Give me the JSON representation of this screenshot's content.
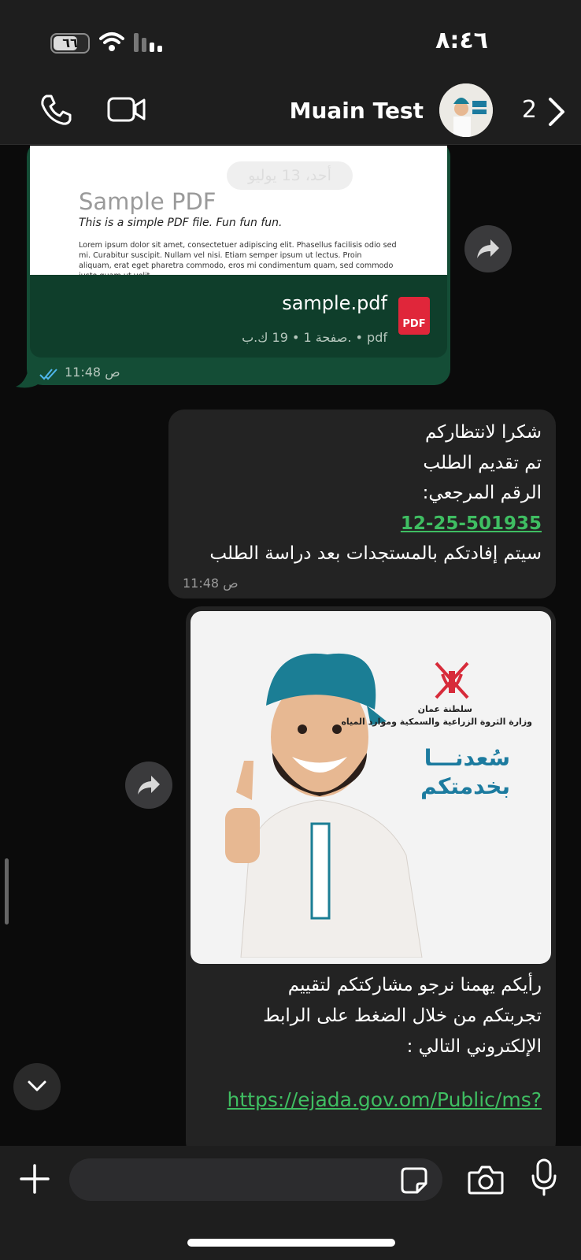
{
  "status_bar": {
    "time": "٨:٤٦",
    "battery": "٦٦"
  },
  "header": {
    "contact_name": "Muain Test",
    "back_count": "2"
  },
  "pdf_message": {
    "preview_date": "أحد، 13 يوليو",
    "preview_title": "Sample PDF",
    "preview_subtitle": "This is a simple PDF file. Fun fun fun.",
    "preview_lorem": "Lorem ipsum dolor sit amet, consectetuer adipiscing elit. Phasellus facilisis odio sed mi. Curabitur suscipit. Nullam vel nisi. Etiam semper ipsum ut lectus. Proin aliquam, erat eget pharetra commodo, eros mi condimentum quam, sed commodo justo quam ut velit.",
    "file_name": "sample.pdf",
    "file_meta": "صفحة 1 • 19 ك.ب. • pdf",
    "icon_label": "PDF",
    "time": "11:48 ص"
  },
  "text_message": {
    "lines": [
      "شكرا لانتظاركم",
      "تم تقديم الطلب",
      "الرقم المرجعي:"
    ],
    "reference": "12-25-501935",
    "last_line": "سيتم إفادتكم بالمستجدات بعد دراسة الطلب",
    "time": "11:48 ص"
  },
  "image_message": {
    "org_line1": "سلطنة عمان",
    "org_line2": "وزارة الثروة الزراعية والسمكية وموارد المياه",
    "happy_line1": "سُعدنـــا",
    "happy_line2": "بخدمتكم",
    "caption_lines": [
      "رأيكم يهمنا نرجو مشاركتكم لتقييم",
      "تجربتكم من خلال الضغط على الرابط",
      "الإلكتروني التالي :"
    ],
    "link": "https://ejada.gov.om/Public/ms?"
  },
  "colors": {
    "accent_green": "#3fbe62",
    "sent_bubble": "#144d36",
    "received_bubble": "#232323"
  }
}
